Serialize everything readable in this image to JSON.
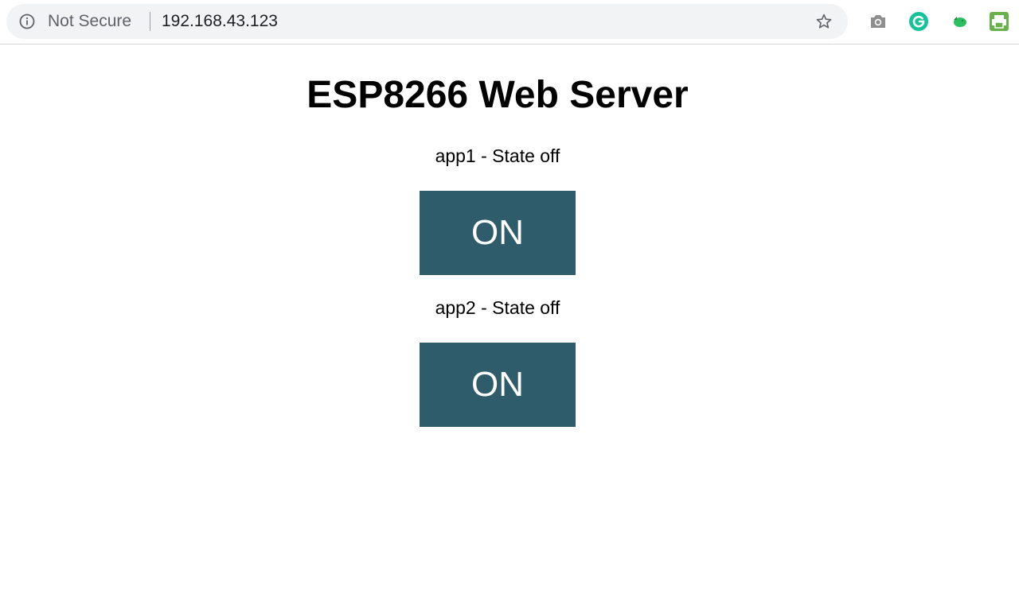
{
  "browser": {
    "security_label": "Not Secure",
    "url": "192.168.43.123",
    "icons": {
      "info": "info-circle-icon",
      "bookmark": "star-icon",
      "extensions": [
        "camera-icon",
        "grammarly-icon",
        "evernote-icon",
        "print-friendly-icon"
      ]
    },
    "colors": {
      "omnibox_bg": "#f1f3f4",
      "grammarly": "#15c39a",
      "evernote": "#2dbe60",
      "print": "#6ab04c"
    }
  },
  "page": {
    "title": "ESP8266 Web Server",
    "apps": [
      {
        "state_label": "app1 - State off",
        "button_label": "ON"
      },
      {
        "state_label": "app2 - State off",
        "button_label": "ON"
      }
    ],
    "colors": {
      "button_bg": "#2f5c6a",
      "button_text": "#ffffff"
    }
  }
}
